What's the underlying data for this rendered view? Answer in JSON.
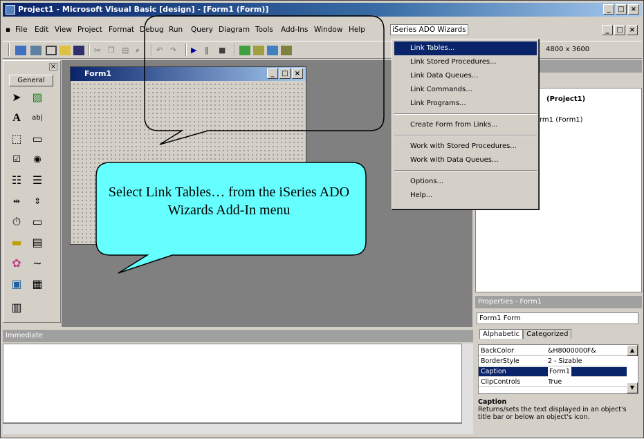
{
  "window": {
    "title": "Project1 - Microsoft Visual Basic [design] - [Form1 (Form)]",
    "btn_min": "_",
    "btn_max": "□",
    "btn_close": "×"
  },
  "menubar": {
    "items": [
      "File",
      "Edit",
      "View",
      "Project",
      "Format",
      "Debug",
      "Run",
      "Query",
      "Diagram",
      "Tools",
      "Add-Ins",
      "Window",
      "Help",
      "iSeries ADO Wizards"
    ]
  },
  "toolbar": {
    "size_readout": "4800 x 3600"
  },
  "toolbox": {
    "tab_label": "General"
  },
  "form": {
    "title": "Form1"
  },
  "dropdown": {
    "items": [
      "Link Tables...",
      "Link Stored Procedures...",
      "Link Data Queues...",
      "Link Commands...",
      "Link Programs...",
      "Create Form from Links...",
      "Work with Stored Procedures...",
      "Work with Data Queues...",
      "Options...",
      "Help..."
    ]
  },
  "project": {
    "node_project": "(Project1)",
    "node_form": "rm1 (Form1)"
  },
  "properties": {
    "title": "Properties - Form1",
    "object": "Form1 Form",
    "tab_alpha": "Alphabetic",
    "tab_cat": "Categorized",
    "rows": [
      {
        "k": "BackColor",
        "v": "&H8000000F&"
      },
      {
        "k": "BorderStyle",
        "v": "2 - Sizable"
      },
      {
        "k": "Caption",
        "v": "Form1"
      },
      {
        "k": "ClipControls",
        "v": "True"
      }
    ],
    "desc_title": "Caption",
    "desc_text": "Returns/sets the text displayed in an object's title bar or below an object's icon."
  },
  "immediate": {
    "title": "Immediate"
  },
  "callout": {
    "text": "Select Link Tables… from the iSeries ADO Wizards Add-In menu"
  }
}
